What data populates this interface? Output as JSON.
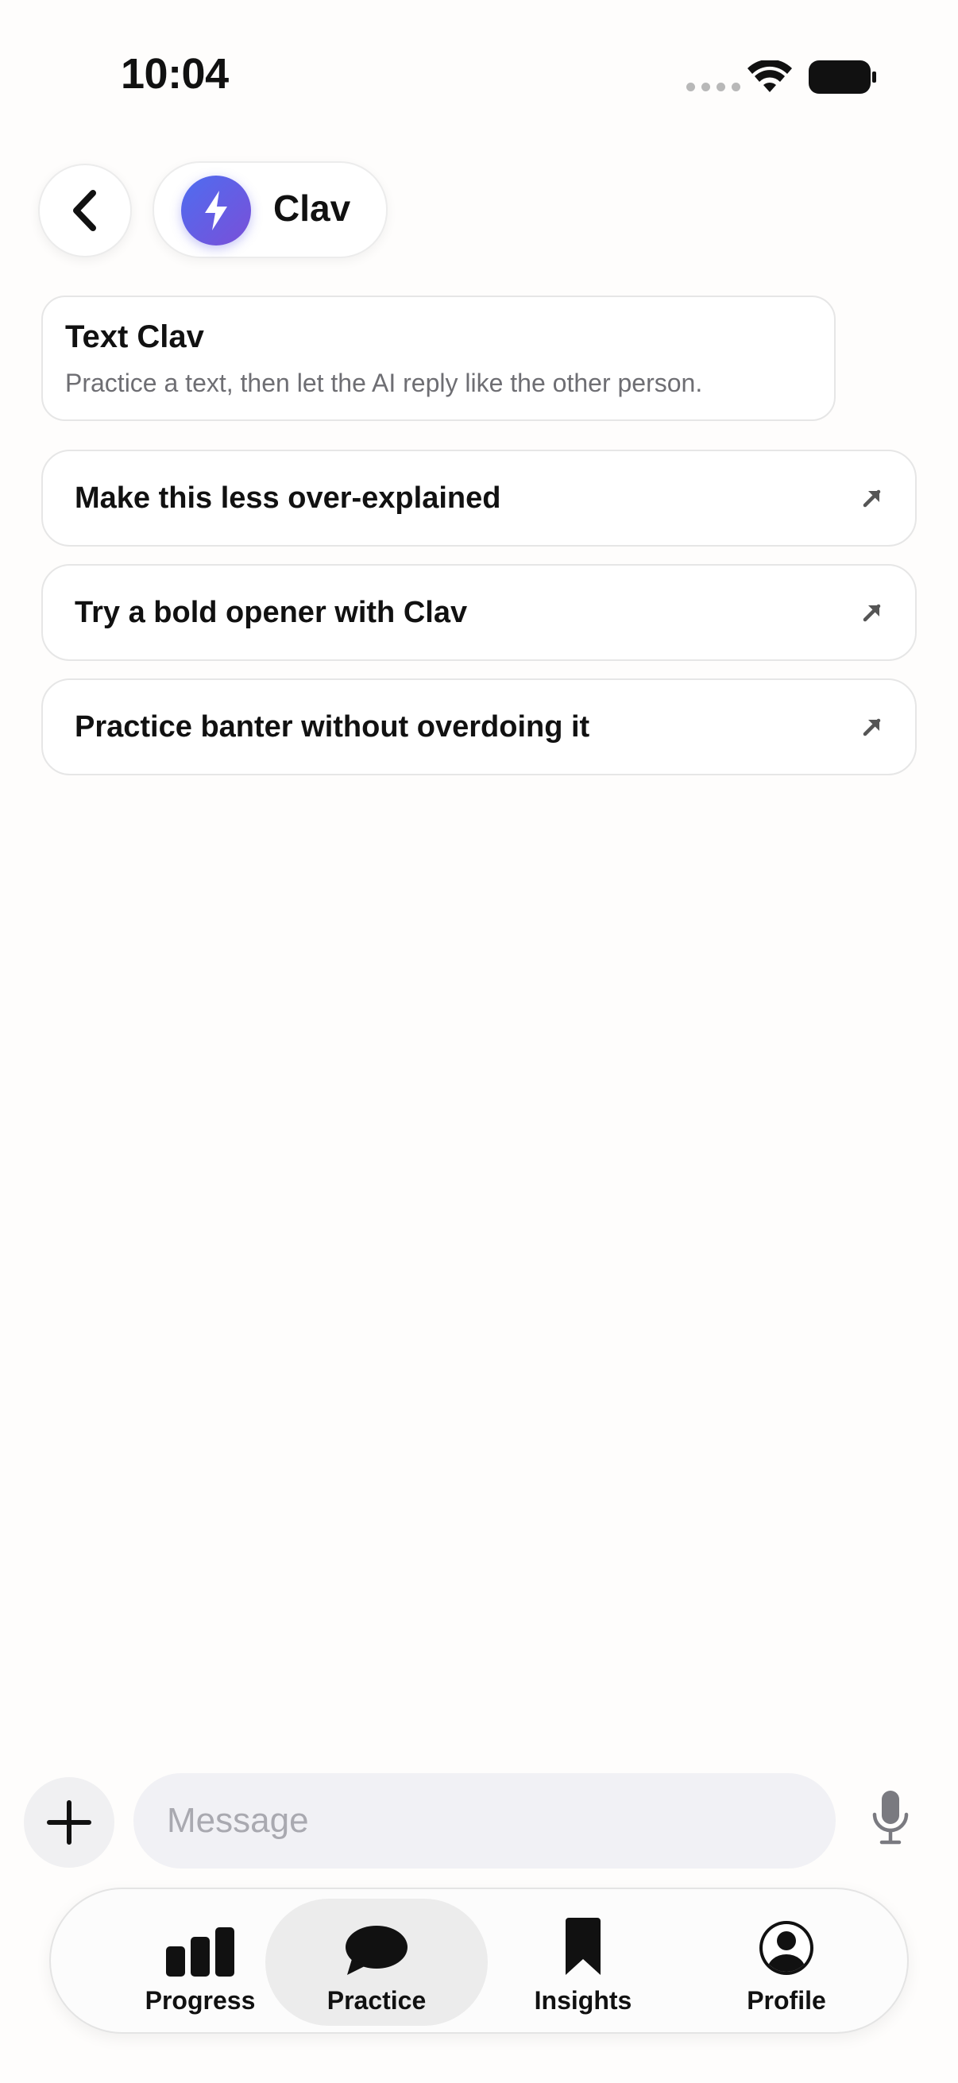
{
  "status_bar": {
    "time": "10:04"
  },
  "header": {
    "assistant_name": "Clav"
  },
  "intro_card": {
    "title": "Text Clav",
    "subtitle": "Practice a text, then let the AI reply like the other person."
  },
  "suggestions": [
    {
      "label": "Make this less over-explained",
      "icon": "arrow-up-right-icon"
    },
    {
      "label": "Try a bold opener with Clav",
      "icon": "arrow-up-right-icon"
    },
    {
      "label": "Practice banter without overdoing it",
      "icon": "arrow-up-right-icon"
    }
  ],
  "composer": {
    "placeholder": "Message"
  },
  "tabs": [
    {
      "label": "Progress",
      "icon": "bar-chart-icon",
      "active": false
    },
    {
      "label": "Practice",
      "icon": "chat-bubble-icon",
      "active": true
    },
    {
      "label": "Insights",
      "icon": "bookmark-icon",
      "active": false
    },
    {
      "label": "Profile",
      "icon": "person-circle-icon",
      "active": false
    }
  ],
  "colors": {
    "accent_start": "#4e6df0",
    "accent_end": "#7a4fd8",
    "active_tab_bg": "#ececec"
  }
}
